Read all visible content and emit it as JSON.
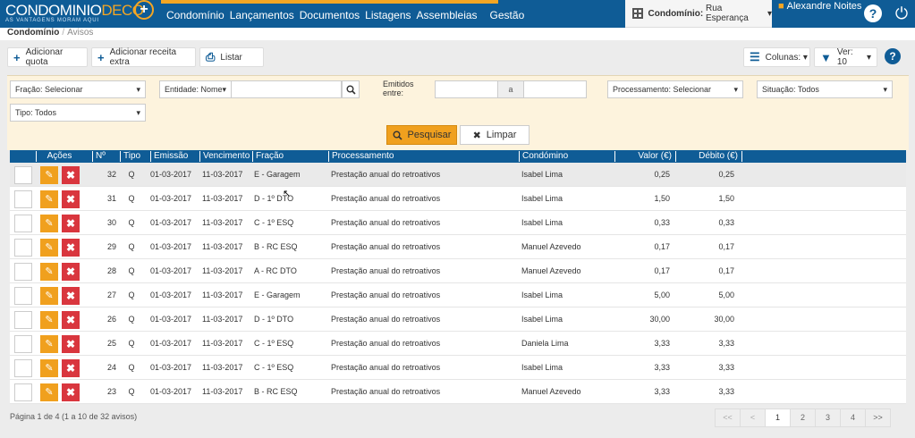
{
  "brand": {
    "name_white": "CONDOMINIO",
    "name_orange": "DECO",
    "tagline": "AS VANTAGENS MORAM AQUI"
  },
  "nav": [
    "Condomínio",
    "Lançamentos",
    "Documentos",
    "Listagens",
    "Assembleias",
    "Gestão"
  ],
  "condo_selector": {
    "label": "Condomínio:",
    "value": "Rua Esperança"
  },
  "user": {
    "name": "Alexandre Noites"
  },
  "breadcrumb": {
    "root": "Condomínio",
    "current": "Avisos"
  },
  "toolbar": {
    "add_quota": "Adicionar quota",
    "add_receita": "Adicionar receita extra",
    "list": "Listar",
    "columns": "Colunas:",
    "view": "Ver: 10"
  },
  "filters": {
    "fracao": "Fração: Selecionar",
    "entidade": "Entidade: Nome",
    "emitidos_label": "Emitidos entre:",
    "a": "a",
    "processamento": "Processamento: Selecionar",
    "situacao": "Situação: Todos",
    "tipo": "Tipo: Todos",
    "search_button": "Pesquisar",
    "clear_button": "Limpar"
  },
  "table": {
    "headers": [
      "Ações",
      "Nº",
      "Tipo",
      "Emissão",
      "Vencimento",
      "Fração",
      "Processamento",
      "Condómino",
      "Valor (€)",
      "Débito (€)"
    ],
    "rows": [
      {
        "n": "32",
        "tipo": "Q",
        "emissao": "01-03-2017",
        "vencimento": "11-03-2017",
        "fracao": "E - Garagem",
        "proc": "Prestação anual do retroativos",
        "condomino": "Isabel Lima",
        "valor": "0,25",
        "debito": "0,25"
      },
      {
        "n": "31",
        "tipo": "Q",
        "emissao": "01-03-2017",
        "vencimento": "11-03-2017",
        "fracao": "D - 1º DTO",
        "proc": "Prestação anual do retroativos",
        "condomino": "Isabel Lima",
        "valor": "1,50",
        "debito": "1,50"
      },
      {
        "n": "30",
        "tipo": "Q",
        "emissao": "01-03-2017",
        "vencimento": "11-03-2017",
        "fracao": "C - 1º ESQ",
        "proc": "Prestação anual do retroativos",
        "condomino": "Isabel Lima",
        "valor": "0,33",
        "debito": "0,33"
      },
      {
        "n": "29",
        "tipo": "Q",
        "emissao": "01-03-2017",
        "vencimento": "11-03-2017",
        "fracao": "B - RC ESQ",
        "proc": "Prestação anual do retroativos",
        "condomino": "Manuel Azevedo",
        "valor": "0,17",
        "debito": "0,17"
      },
      {
        "n": "28",
        "tipo": "Q",
        "emissao": "01-03-2017",
        "vencimento": "11-03-2017",
        "fracao": "A - RC DTO",
        "proc": "Prestação anual do retroativos",
        "condomino": "Manuel Azevedo",
        "valor": "0,17",
        "debito": "0,17"
      },
      {
        "n": "27",
        "tipo": "Q",
        "emissao": "01-03-2017",
        "vencimento": "11-03-2017",
        "fracao": "E - Garagem",
        "proc": "Prestação anual do retroativos",
        "condomino": "Isabel Lima",
        "valor": "5,00",
        "debito": "5,00"
      },
      {
        "n": "26",
        "tipo": "Q",
        "emissao": "01-03-2017",
        "vencimento": "11-03-2017",
        "fracao": "D - 1º DTO",
        "proc": "Prestação anual do retroativos",
        "condomino": "Isabel Lima",
        "valor": "30,00",
        "debito": "30,00"
      },
      {
        "n": "25",
        "tipo": "Q",
        "emissao": "01-03-2017",
        "vencimento": "11-03-2017",
        "fracao": "C - 1º ESQ",
        "proc": "Prestação anual do retroativos",
        "condomino": "Daniela Lima",
        "valor": "3,33",
        "debito": "3,33"
      },
      {
        "n": "24",
        "tipo": "Q",
        "emissao": "01-03-2017",
        "vencimento": "11-03-2017",
        "fracao": "C - 1º ESQ",
        "proc": "Prestação anual do retroativos",
        "condomino": "Isabel Lima",
        "valor": "3,33",
        "debito": "3,33"
      },
      {
        "n": "23",
        "tipo": "Q",
        "emissao": "01-03-2017",
        "vencimento": "11-03-2017",
        "fracao": "B - RC ESQ",
        "proc": "Prestação anual do retroativos",
        "condomino": "Manuel Azevedo",
        "valor": "3,33",
        "debito": "3,33"
      }
    ]
  },
  "footer": {
    "summary": "Página 1 de 4 (1 a 10 de 32 avisos)"
  },
  "pager": [
    "<<",
    "<",
    "1",
    "2",
    "3",
    "4",
    ">>"
  ],
  "colors": {
    "primary": "#0f5c96",
    "accent": "#f0a01e",
    "danger": "#d9363e",
    "filter_bg": "#fdf3dd"
  }
}
